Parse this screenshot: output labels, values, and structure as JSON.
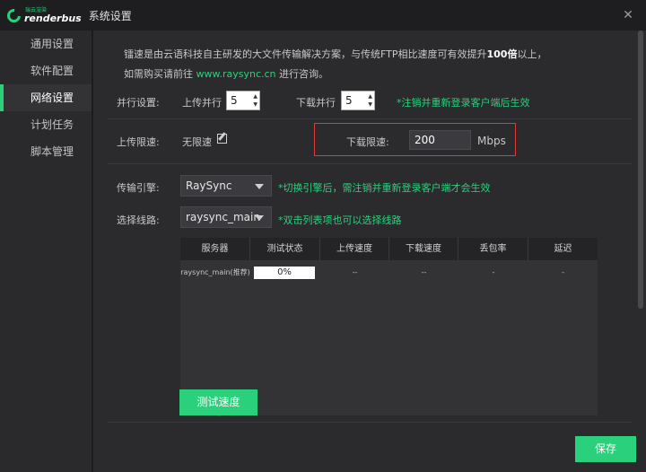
{
  "window": {
    "logo_cn": "瑞云渲染",
    "logo_en": "renderbus",
    "title": "系统设置",
    "close": "✕"
  },
  "sidebar": {
    "items": [
      {
        "label": "通用设置"
      },
      {
        "label": "软件配置"
      },
      {
        "label": "网络设置"
      },
      {
        "label": "计划任务"
      },
      {
        "label": "脚本管理"
      }
    ],
    "active_index": 2
  },
  "intro": {
    "line1_a": "镭速是由云语科技自主研发的大文件传输解决方案，与传统FTP相比速度可有效提升",
    "line1_b": "100倍",
    "line1_c": "以上，",
    "line2_a": "如需购买请前往",
    "line2_link": "www.raysync.cn",
    "line2_b": "进行咨询。"
  },
  "parallel": {
    "label": "并行设置:",
    "upload_label": "上传并行",
    "upload_value": "5",
    "download_label": "下载并行",
    "download_value": "5",
    "note": "*注销并重新登录客户端后生效"
  },
  "speed_limit": {
    "label": "上传限速:",
    "upload_value": "无限速",
    "download_label": "下载限速:",
    "download_value": "200",
    "unit": "Mbps"
  },
  "engine": {
    "label": "传输引擎:",
    "value": "RaySync",
    "note": "*切换引擎后，需注销并重新登录客户端才会生效"
  },
  "line": {
    "label": "选择线路:",
    "value": "raysync_main",
    "note": "*双击列表项也可以选择线路"
  },
  "table": {
    "columns": [
      "服务器",
      "测试状态",
      "上传速度",
      "下载速度",
      "丢包率",
      "延迟"
    ],
    "rows": [
      {
        "server": "raysync_main(推荐)",
        "status": "0%",
        "upload": "--",
        "download": "--",
        "loss": "-",
        "latency": "-"
      }
    ]
  },
  "buttons": {
    "test_speed": "测试速度",
    "save": "保存"
  },
  "colors": {
    "accent": "#2ad07b",
    "highlight_border": "#e03b3b"
  }
}
